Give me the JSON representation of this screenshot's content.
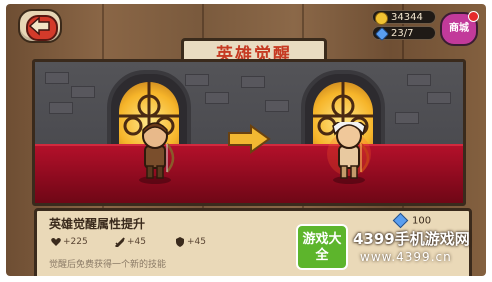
{
  "header": {
    "title": "英雄觉醒",
    "back_icon": "back-arrow-icon"
  },
  "resources": {
    "gold": "34344",
    "gems": "23/7",
    "shop_label": "商城"
  },
  "scene": {
    "arrow_icon": "right-arrow-icon"
  },
  "awaken_panel": {
    "title": "英雄觉醒属性提升",
    "stats": [
      {
        "icon": "heart-icon",
        "value": "+225"
      },
      {
        "icon": "sword-icon",
        "value": "+45"
      },
      {
        "icon": "shield-icon",
        "value": "+45"
      }
    ],
    "description": "觉醒后免费获得一个新的技能",
    "cost": "100"
  },
  "watermark": {
    "badge": "游戏大全",
    "brand": "4399手机游戏网",
    "url": "www.4399.cn"
  },
  "colors": {
    "title_red": "#c63a22",
    "floor_red": "#b3102a",
    "shop_purple": "#c23a9a",
    "badge_green": "#5db52c"
  }
}
